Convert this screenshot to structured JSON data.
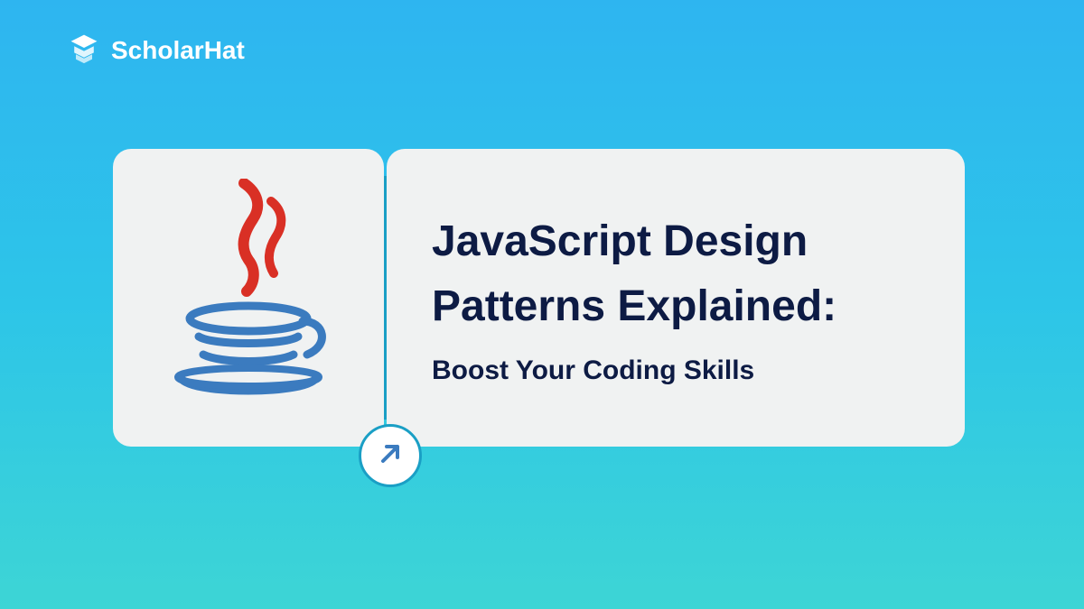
{
  "logo": {
    "text": "ScholarHat"
  },
  "title": {
    "line1": "JavaScript Design",
    "line2": "Patterns Explained:",
    "subtitle": "Boost Your Coding Skills"
  }
}
